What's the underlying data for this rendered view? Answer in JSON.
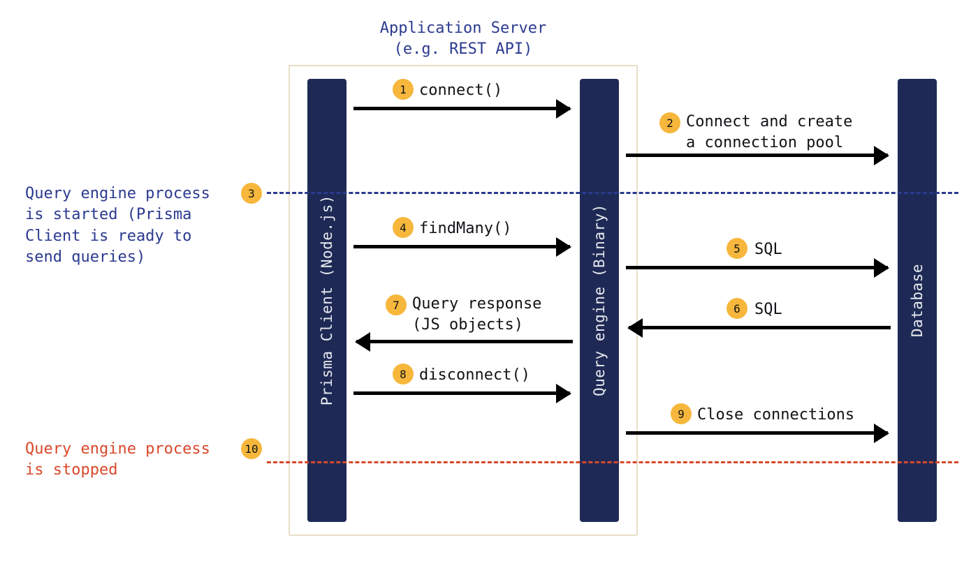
{
  "header": {
    "title_line1": "Application Server",
    "title_line2": "(e.g. REST API)"
  },
  "pillars": {
    "client": "Prisma Client (Node.js)",
    "engine": "Query engine (Binary)",
    "database": "Database"
  },
  "steps": {
    "s1": "connect()",
    "s2_line1": "Connect and create",
    "s2_line2": "a connection pool",
    "s3": "Query engine process is started (Prisma Client is ready to send queries)",
    "s4": "findMany()",
    "s5": "SQL",
    "s6": "SQL",
    "s7_line1": "Query response",
    "s7_line2": "(JS objects)",
    "s8": "disconnect()",
    "s9": "Close connections",
    "s10": "Query engine process is stopped"
  },
  "badges": {
    "b1": "1",
    "b2": "2",
    "b3": "3",
    "b4": "4",
    "b5": "5",
    "b6": "6",
    "b7": "7",
    "b8": "8",
    "b9": "9",
    "b10": "10"
  },
  "chart_data": {
    "type": "sequence-diagram",
    "participants": [
      "Prisma Client (Node.js)",
      "Query engine (Binary)",
      "Database"
    ],
    "container": {
      "label": "Application Server (e.g. REST API)",
      "wraps": [
        "Prisma Client (Node.js)",
        "Query engine (Binary)"
      ]
    },
    "messages": [
      {
        "n": 1,
        "from": "Prisma Client (Node.js)",
        "to": "Query engine (Binary)",
        "label": "connect()"
      },
      {
        "n": 2,
        "from": "Query engine (Binary)",
        "to": "Database",
        "label": "Connect and create a connection pool"
      },
      {
        "n": 3,
        "type": "separator",
        "label": "Query engine process is started (Prisma Client is ready to send queries)",
        "color": "blue"
      },
      {
        "n": 4,
        "from": "Prisma Client (Node.js)",
        "to": "Query engine (Binary)",
        "label": "findMany()"
      },
      {
        "n": 5,
        "from": "Query engine (Binary)",
        "to": "Database",
        "label": "SQL"
      },
      {
        "n": 6,
        "from": "Database",
        "to": "Query engine (Binary)",
        "label": "SQL"
      },
      {
        "n": 7,
        "from": "Query engine (Binary)",
        "to": "Prisma Client (Node.js)",
        "label": "Query response (JS objects)"
      },
      {
        "n": 8,
        "from": "Prisma Client (Node.js)",
        "to": "Query engine (Binary)",
        "label": "disconnect()"
      },
      {
        "n": 9,
        "from": "Query engine (Binary)",
        "to": "Database",
        "label": "Close connections"
      },
      {
        "n": 10,
        "type": "separator",
        "label": "Query engine process is stopped",
        "color": "red"
      }
    ]
  }
}
